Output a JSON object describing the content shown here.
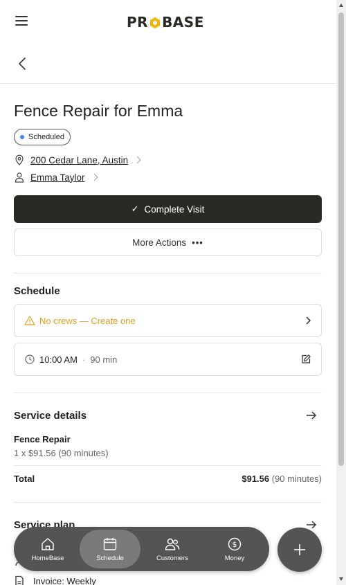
{
  "brand": {
    "logo_left": "PR",
    "logo_right": "BASE",
    "accent": "#f5b400"
  },
  "job": {
    "title": "Fence Repair for Emma",
    "status": "Scheduled",
    "address": "200 Cedar Lane, Austin",
    "customer": "Emma Taylor"
  },
  "actions": {
    "complete_label": "Complete Visit",
    "more_label": "More Actions"
  },
  "schedule": {
    "heading": "Schedule",
    "crew_warning": "No crews — Create one",
    "time": "10:00 AM",
    "duration": "90 min"
  },
  "service": {
    "heading": "Service details",
    "name": "Fence Repair",
    "qty_line": "1 x $91.56 (90 minutes)",
    "total_label": "Total",
    "total_amount": "$91.56",
    "total_note": "(90 minutes)"
  },
  "plan": {
    "heading": "Service plan",
    "invoice": "Invoice: Weekly"
  },
  "nav": {
    "items": [
      {
        "label": "HomeBase",
        "icon": "home-icon"
      },
      {
        "label": "Schedule",
        "icon": "calendar-icon"
      },
      {
        "label": "Customers",
        "icon": "people-icon"
      },
      {
        "label": "Money",
        "icon": "dollar-icon"
      }
    ],
    "active": "Schedule"
  },
  "colors": {
    "primary": "#2b2926",
    "warning": "#d9a21b",
    "status_dot": "#3b82f6",
    "nav_bg": "#545454"
  }
}
